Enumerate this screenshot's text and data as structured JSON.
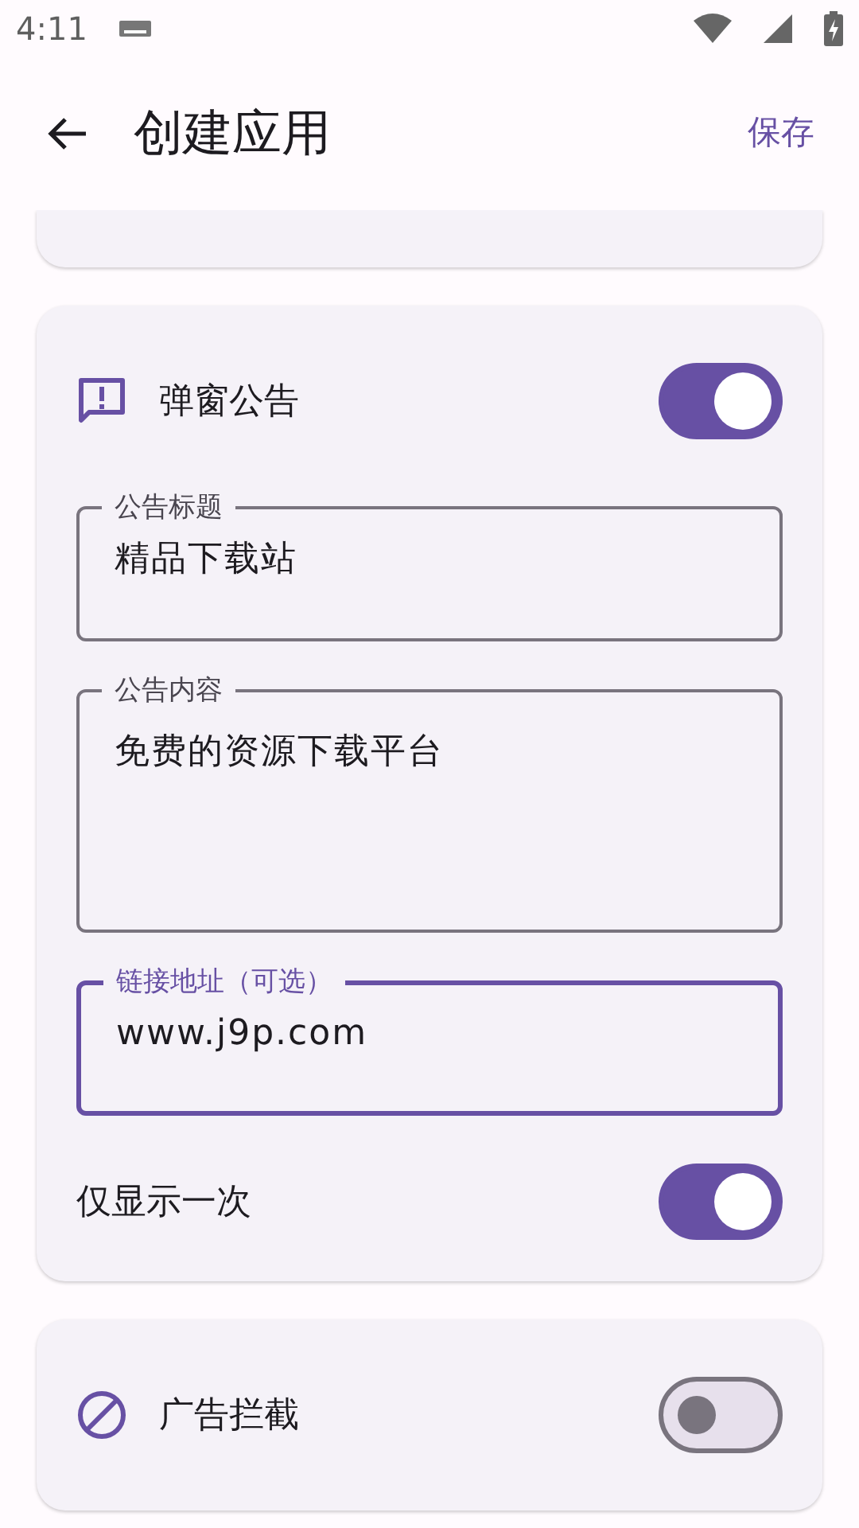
{
  "status_bar": {
    "time": "4:11"
  },
  "app_bar": {
    "title": "创建应用",
    "action": "保存"
  },
  "popup_card": {
    "title": "弹窗公告",
    "on": true,
    "fields": [
      {
        "label": "公告标题",
        "value": "精品下载站",
        "multiline": false,
        "focused": false
      },
      {
        "label": "公告内容",
        "value": "免费的资源下载平台",
        "multiline": true,
        "focused": false
      },
      {
        "label": "链接地址（可选）",
        "value": "www.j9p.com",
        "multiline": false,
        "focused": true
      }
    ],
    "once": {
      "label": "仅显示一次",
      "on": true
    }
  },
  "adblock_card": {
    "title": "广告拦截",
    "on": false
  }
}
